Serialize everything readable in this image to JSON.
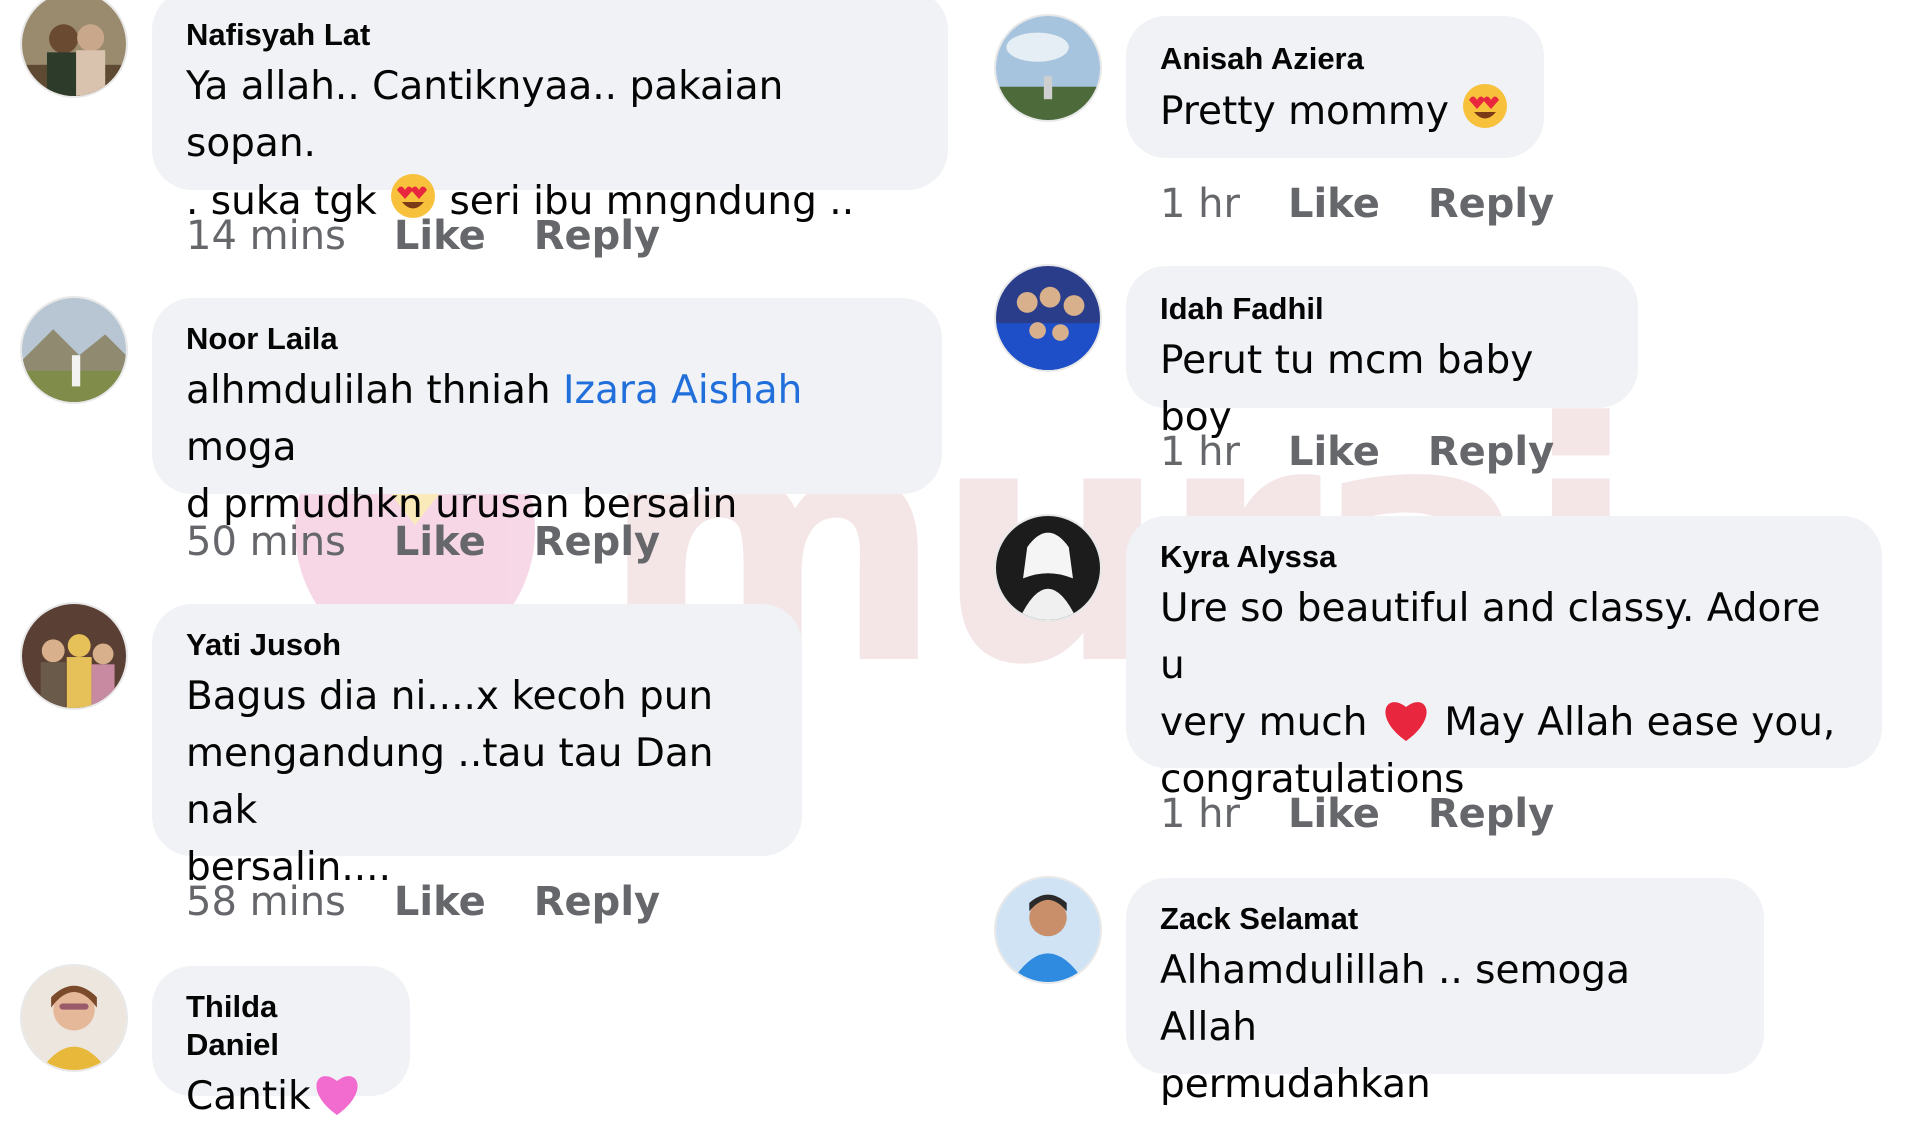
{
  "watermark": {
    "text": "murai"
  },
  "left_column": [
    {
      "name": "Nafisyah Lat",
      "text_lines": [
        "Ya allah.. Cantiknyaa.. pakaian sopan.",
        ". suka tgk",
        "seri ibu mngndung .."
      ],
      "time": "14 mins",
      "like": "Like",
      "reply": "Reply",
      "avatar": "couple-avatar-icon"
    },
    {
      "name": "Noor Laila",
      "text_before": "alhmdulilah thniah",
      "mention": "Izara Aishah",
      "text_after": "moga",
      "text_line2": "d prmudhkn urusan bersalin",
      "time": "50 mins",
      "like": "Like",
      "reply": "Reply",
      "avatar": "landscape-avatar-icon"
    },
    {
      "name": "Yati Jusoh",
      "text_lines": [
        "Bagus dia ni....x kecoh pun",
        "mengandung ..tau tau Dan nak",
        "bersalin...."
      ],
      "time": "58 mins",
      "like": "Like",
      "reply": "Reply",
      "avatar": "family-avatar-icon"
    },
    {
      "name": "Thilda Daniel",
      "text": "Cantik",
      "avatar": "woman-avatar-icon"
    }
  ],
  "right_column": [
    {
      "name": "Anisah Aziera",
      "text": "Pretty mommy",
      "time": "1 hr",
      "like": "Like",
      "reply": "Reply",
      "avatar": "sky-avatar-icon"
    },
    {
      "name": "Idah Fadhil",
      "text": "Perut tu mcm baby boy",
      "time": "1 hr",
      "like": "Like",
      "reply": "Reply",
      "avatar": "blue-family-avatar-icon"
    },
    {
      "name": "Kyra Alyssa",
      "text_line1": "Ure so beautiful and classy. Adore u",
      "text_line2a": "very much",
      "text_line2b": "May Allah ease you,",
      "text_line3": "congratulations",
      "time": "1 hr",
      "like": "Like",
      "reply": "Reply",
      "avatar": "bride-avatar-icon"
    },
    {
      "name": "Zack Selamat",
      "text_lines": [
        "Alhamdulillah .. semoga Allah",
        "permudahkan"
      ],
      "avatar": "child-avatar-icon"
    }
  ],
  "colors": {
    "bubble": "#f0f2f5",
    "meta": "#65676b",
    "mention": "#216fdb",
    "heart": "#e8273f"
  }
}
